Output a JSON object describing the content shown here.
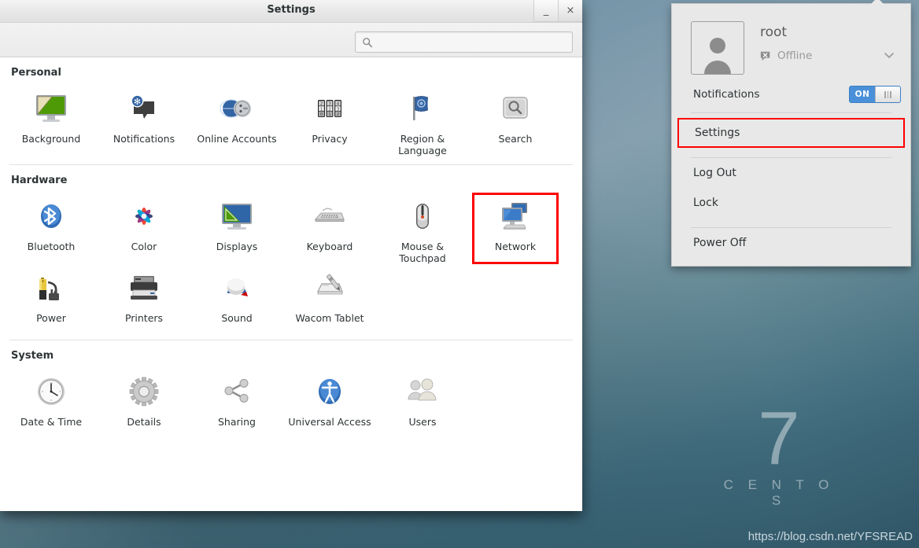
{
  "desktop": {
    "brand_number": "7",
    "brand_name": "C E N T O S",
    "watermark_url": "https://blog.csdn.net/YFSREAD"
  },
  "window": {
    "title": "Settings",
    "minimize_label": "_",
    "close_label": "×",
    "search": {
      "value": "",
      "placeholder": ""
    }
  },
  "sections": [
    {
      "title": "Personal",
      "items": [
        {
          "label": "Background",
          "icon": "background-icon"
        },
        {
          "label": "Notifications",
          "icon": "notifications-icon"
        },
        {
          "label": "Online Accounts",
          "icon": "online-accounts-icon"
        },
        {
          "label": "Privacy",
          "icon": "privacy-icon"
        },
        {
          "label": "Region & Language",
          "icon": "region-language-icon"
        },
        {
          "label": "Search",
          "icon": "search-settings-icon"
        }
      ]
    },
    {
      "title": "Hardware",
      "items": [
        {
          "label": "Bluetooth",
          "icon": "bluetooth-icon"
        },
        {
          "label": "Color",
          "icon": "color-icon"
        },
        {
          "label": "Displays",
          "icon": "displays-icon"
        },
        {
          "label": "Keyboard",
          "icon": "keyboard-icon"
        },
        {
          "label": "Mouse & Touchpad",
          "icon": "mouse-touchpad-icon"
        },
        {
          "label": "Network",
          "icon": "network-icon",
          "highlighted": true
        },
        {
          "label": "Power",
          "icon": "power-icon"
        },
        {
          "label": "Printers",
          "icon": "printers-icon"
        },
        {
          "label": "Sound",
          "icon": "sound-icon"
        },
        {
          "label": "Wacom Tablet",
          "icon": "wacom-tablet-icon"
        }
      ]
    },
    {
      "title": "System",
      "items": [
        {
          "label": "Date & Time",
          "icon": "date-time-icon"
        },
        {
          "label": "Details",
          "icon": "details-icon"
        },
        {
          "label": "Sharing",
          "icon": "sharing-icon"
        },
        {
          "label": "Universal Access",
          "icon": "universal-access-icon"
        },
        {
          "label": "Users",
          "icon": "users-icon"
        }
      ]
    }
  ],
  "user_panel": {
    "user_name": "root",
    "status": "Offline",
    "notifications_label": "Notifications",
    "notifications_state": "ON",
    "menu_items": [
      {
        "label": "Settings",
        "highlighted": true
      },
      {
        "label": "Log Out"
      },
      {
        "label": "Lock"
      },
      {
        "label": "Power Off"
      }
    ]
  },
  "colors": {
    "highlight_red": "#ff0000",
    "toggle_blue": "#4a90d9",
    "panel_bg": "#e8e8e8"
  }
}
